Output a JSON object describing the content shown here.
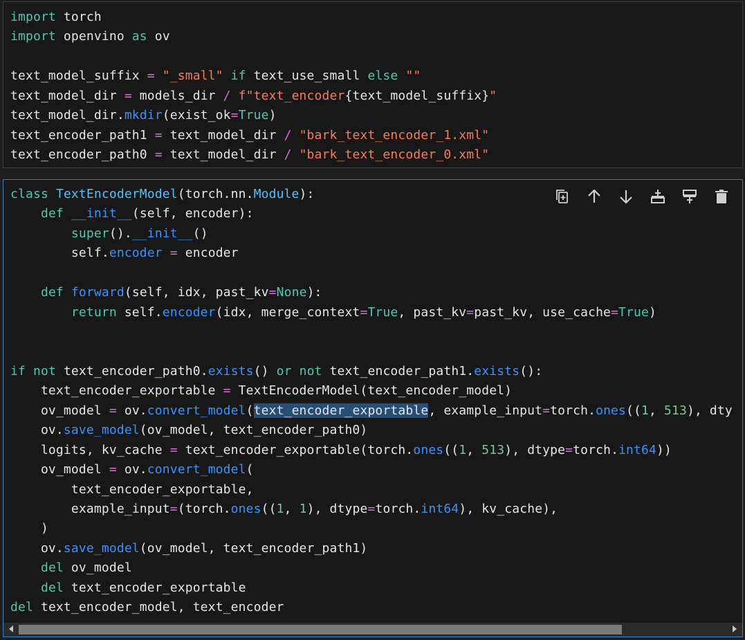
{
  "cells": [
    {
      "lines": [
        [
          [
            "kg",
            "import"
          ],
          [
            "n",
            " torch"
          ]
        ],
        [
          [
            "kg",
            "import"
          ],
          [
            "n",
            " openvino "
          ],
          [
            "kg",
            "as"
          ],
          [
            "n",
            " ov"
          ]
        ],
        [],
        [
          [
            "n",
            "text_model_suffix "
          ],
          [
            "o",
            "="
          ],
          [
            "n",
            " "
          ],
          [
            "s",
            "\"_small\""
          ],
          [
            "n",
            " "
          ],
          [
            "kg",
            "if"
          ],
          [
            "n",
            " text_use_small "
          ],
          [
            "kg",
            "else"
          ],
          [
            "n",
            " "
          ],
          [
            "s",
            "\"\""
          ]
        ],
        [
          [
            "n",
            "text_model_dir "
          ],
          [
            "o",
            "="
          ],
          [
            "n",
            " models_dir "
          ],
          [
            "o",
            "/"
          ],
          [
            "n",
            " "
          ],
          [
            "s",
            "f\"text_encoder"
          ],
          [
            "p",
            "{"
          ],
          [
            "n",
            "text_model_suffix"
          ],
          [
            "p",
            "}"
          ],
          [
            "s",
            "\""
          ]
        ],
        [
          [
            "n",
            "text_model_dir."
          ],
          [
            "f",
            "mkdir"
          ],
          [
            "n",
            "(exist_ok"
          ],
          [
            "o",
            "="
          ],
          [
            "kg",
            "True"
          ],
          [
            "n",
            ")"
          ]
        ],
        [
          [
            "n",
            "text_encoder_path1 "
          ],
          [
            "o",
            "="
          ],
          [
            "n",
            " text_model_dir "
          ],
          [
            "o",
            "/"
          ],
          [
            "n",
            " "
          ],
          [
            "s",
            "\"bark_text_encoder_1.xml\""
          ]
        ],
        [
          [
            "n",
            "text_encoder_path0 "
          ],
          [
            "o",
            "="
          ],
          [
            "n",
            " text_model_dir "
          ],
          [
            "o",
            "/"
          ],
          [
            "n",
            " "
          ],
          [
            "s",
            "\"bark_text_encoder_0.xml\""
          ]
        ]
      ]
    },
    {
      "lines": [
        [
          [
            "kg",
            "class"
          ],
          [
            "n",
            " "
          ],
          [
            "c",
            "TextEncoderModel"
          ],
          [
            "n",
            "(torch.nn."
          ],
          [
            "c",
            "Module"
          ],
          [
            "n",
            "):"
          ]
        ],
        [
          [
            "n",
            "    "
          ],
          [
            "kg",
            "def"
          ],
          [
            "n",
            " "
          ],
          [
            "f",
            "__init__"
          ],
          [
            "n",
            "(self, encoder):"
          ]
        ],
        [
          [
            "n",
            "        "
          ],
          [
            "kg",
            "super"
          ],
          [
            "n",
            "()."
          ],
          [
            "f",
            "__init__"
          ],
          [
            "n",
            "()"
          ]
        ],
        [
          [
            "n",
            "        self."
          ],
          [
            "f",
            "encoder"
          ],
          [
            "n",
            " "
          ],
          [
            "o",
            "="
          ],
          [
            "n",
            " encoder"
          ]
        ],
        [],
        [
          [
            "n",
            "    "
          ],
          [
            "kg",
            "def"
          ],
          [
            "n",
            " "
          ],
          [
            "f",
            "forward"
          ],
          [
            "n",
            "(self, idx, past_kv"
          ],
          [
            "o",
            "="
          ],
          [
            "kg",
            "None"
          ],
          [
            "n",
            "):"
          ]
        ],
        [
          [
            "n",
            "        "
          ],
          [
            "kg",
            "return"
          ],
          [
            "n",
            " self."
          ],
          [
            "f",
            "encoder"
          ],
          [
            "n",
            "(idx, merge_context"
          ],
          [
            "o",
            "="
          ],
          [
            "kg",
            "True"
          ],
          [
            "n",
            ", past_kv"
          ],
          [
            "o",
            "="
          ],
          [
            "n",
            "past_kv, use_cache"
          ],
          [
            "o",
            "="
          ],
          [
            "kg",
            "True"
          ],
          [
            "n",
            ")"
          ]
        ],
        [],
        [],
        [
          [
            "kg",
            "if"
          ],
          [
            "n",
            " "
          ],
          [
            "kg",
            "not"
          ],
          [
            "n",
            " text_encoder_path0."
          ],
          [
            "f",
            "exists"
          ],
          [
            "n",
            "() "
          ],
          [
            "kg",
            "or"
          ],
          [
            "n",
            " "
          ],
          [
            "kg",
            "not"
          ],
          [
            "n",
            " text_encoder_path1."
          ],
          [
            "f",
            "exists"
          ],
          [
            "n",
            "():"
          ]
        ],
        [
          [
            "n",
            "    text_encoder_exportable "
          ],
          [
            "o",
            "="
          ],
          [
            "n",
            " TextEncoderModel(text_encoder_model)"
          ]
        ],
        [
          [
            "n",
            "    ov_model "
          ],
          [
            "o",
            "="
          ],
          [
            "n",
            " ov."
          ],
          [
            "f",
            "convert_model"
          ],
          [
            "n",
            "("
          ],
          [
            "hl",
            "text_encoder_exportable"
          ],
          [
            "n",
            ", example_input"
          ],
          [
            "o",
            "="
          ],
          [
            "n",
            "torch."
          ],
          [
            "f",
            "ones"
          ],
          [
            "n",
            "(("
          ],
          [
            "num",
            "1"
          ],
          [
            "n",
            ", "
          ],
          [
            "num",
            "513"
          ],
          [
            "n",
            "), dty"
          ]
        ],
        [
          [
            "n",
            "    ov."
          ],
          [
            "f",
            "save_model"
          ],
          [
            "n",
            "(ov_model, text_encoder_path0)"
          ]
        ],
        [
          [
            "n",
            "    logits, kv_cache "
          ],
          [
            "o",
            "="
          ],
          [
            "n",
            " text_encoder_exportable(torch."
          ],
          [
            "f",
            "ones"
          ],
          [
            "n",
            "(("
          ],
          [
            "num",
            "1"
          ],
          [
            "n",
            ", "
          ],
          [
            "num",
            "513"
          ],
          [
            "n",
            "), dtype"
          ],
          [
            "o",
            "="
          ],
          [
            "n",
            "torch."
          ],
          [
            "f",
            "int64"
          ],
          [
            "n",
            "))"
          ]
        ],
        [
          [
            "n",
            "    ov_model "
          ],
          [
            "o",
            "="
          ],
          [
            "n",
            " ov."
          ],
          [
            "f",
            "convert_model"
          ],
          [
            "n",
            "("
          ]
        ],
        [
          [
            "n",
            "        text_encoder_exportable,"
          ]
        ],
        [
          [
            "n",
            "        example_input"
          ],
          [
            "o",
            "="
          ],
          [
            "n",
            "(torch."
          ],
          [
            "f",
            "ones"
          ],
          [
            "n",
            "(("
          ],
          [
            "num",
            "1"
          ],
          [
            "n",
            ", "
          ],
          [
            "num",
            "1"
          ],
          [
            "n",
            "), dtype"
          ],
          [
            "o",
            "="
          ],
          [
            "n",
            "torch."
          ],
          [
            "f",
            "int64"
          ],
          [
            "n",
            "), kv_cache),"
          ]
        ],
        [
          [
            "n",
            "    )"
          ]
        ],
        [
          [
            "n",
            "    ov."
          ],
          [
            "f",
            "save_model"
          ],
          [
            "n",
            "(ov_model, text_encoder_path1)"
          ]
        ],
        [
          [
            "n",
            "    "
          ],
          [
            "kg",
            "del"
          ],
          [
            "n",
            " ov_model"
          ]
        ],
        [
          [
            "n",
            "    "
          ],
          [
            "kg",
            "del"
          ],
          [
            "n",
            " text_encoder_exportable"
          ]
        ],
        [
          [
            "kg",
            "del"
          ],
          [
            "n",
            " text_encoder_model, text_encoder"
          ]
        ]
      ]
    }
  ],
  "toolbar": {
    "buttons": [
      {
        "name": "duplicate-cell-button",
        "icon": "copy-icon"
      },
      {
        "name": "move-up-button",
        "icon": "arrow-up-icon"
      },
      {
        "name": "move-down-button",
        "icon": "arrow-down-icon"
      },
      {
        "name": "insert-above-button",
        "icon": "insert-above-icon"
      },
      {
        "name": "insert-below-button",
        "icon": "insert-below-icon"
      },
      {
        "name": "delete-cell-button",
        "icon": "trash-icon"
      }
    ]
  },
  "scrollbar": {
    "horizontal_position": 0.0
  }
}
